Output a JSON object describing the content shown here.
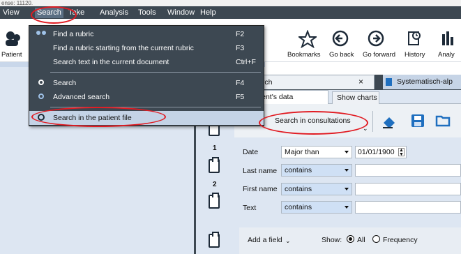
{
  "titlebar": {
    "text": "ense: 11120."
  },
  "menubar": {
    "items": [
      {
        "label": "View",
        "active": false
      },
      {
        "label": "Search",
        "active": true
      },
      {
        "label": "Take",
        "active": false
      },
      {
        "label": "Analysis",
        "active": false
      },
      {
        "label": "Tools",
        "active": false
      },
      {
        "label": "Window",
        "active": false
      },
      {
        "label": "Help",
        "active": false
      }
    ]
  },
  "toolbar": {
    "patient_label": "Patient",
    "bookmarks_label": "Bookmarks",
    "go_back_label": "Go back",
    "go_forward_label": "Go forward",
    "history_label": "History",
    "analysis_label": "Analy"
  },
  "search_menu": {
    "items": [
      {
        "label": "Find a rubric",
        "shortcut": "F2",
        "icon": "binoculars-icon"
      },
      {
        "label": "Find a rubric starting from the current rubric",
        "shortcut": "F3",
        "icon": ""
      },
      {
        "label": "Search text in the current document",
        "shortcut": "Ctrl+F",
        "icon": ""
      },
      {
        "label": "Search",
        "shortcut": "F4",
        "icon": "magnifier-icon"
      },
      {
        "label": "Advanced search",
        "shortcut": "F5",
        "icon": "advanced-search-icon"
      },
      {
        "label": "Search in the patient file",
        "shortcut": "",
        "icon": "patient-search-icon",
        "highlighted": true
      }
    ]
  },
  "document_tabs": {
    "tab1_label": "arch",
    "tab1_close": "×",
    "tab2_label": "Systematisch-alp"
  },
  "sub_tabs": {
    "tab1_label": "for patient's data",
    "tab2_label": "Show charts"
  },
  "actions": {
    "search_in_consultations_label": "Search in consultations"
  },
  "timeline": {
    "numbers": [
      "1",
      "2"
    ]
  },
  "filters": [
    {
      "field": "Date",
      "operator": "Major than",
      "value": "01/01/1900"
    },
    {
      "field": "Last name",
      "operator": "contains",
      "value": ""
    },
    {
      "field": "First name",
      "operator": "contains",
      "value": ""
    },
    {
      "field": "Text",
      "operator": "contains",
      "value": ""
    }
  ],
  "add_bar": {
    "add_field_label": "Add a field",
    "show_label": "Show:",
    "option_all": "All",
    "option_frequency": "Frequency",
    "selected": "All"
  },
  "colors": {
    "menu_bg": "#3d4852",
    "pane_bg": "#dde6f2",
    "annotation_red": "#e11b22",
    "accent_blue": "#1f6fbf"
  }
}
